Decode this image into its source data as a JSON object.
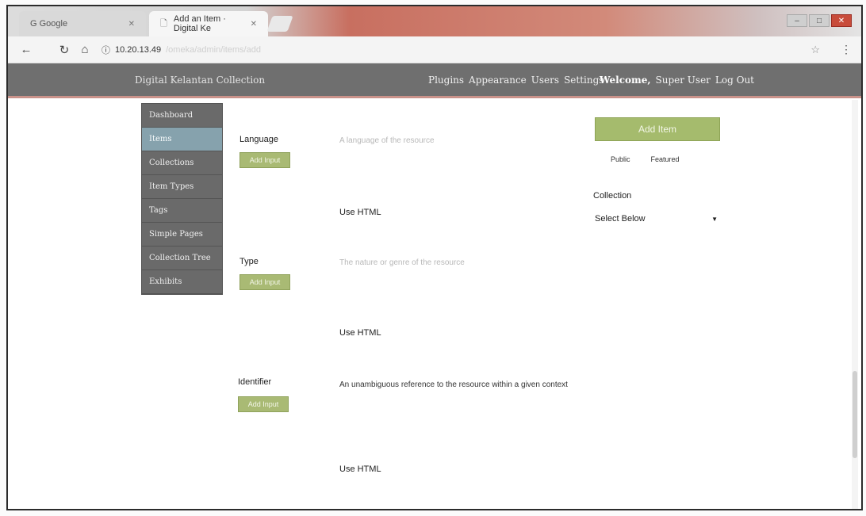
{
  "browser": {
    "tabs": [
      {
        "label": "G Google",
        "active": false
      },
      {
        "label": "Add an Item · Digital Ke",
        "active": true
      }
    ],
    "url": "10.20.13.49",
    "url_rest": "/omeka/admin/items/add"
  },
  "admin": {
    "site_title": "Digital Kelantan Collection",
    "nav": [
      "Plugins",
      "Appearance",
      "Users",
      "Settings"
    ],
    "welcome_prefix": "Welcome,",
    "user": "Super User",
    "logout": "Log Out"
  },
  "sidebar": {
    "items": [
      {
        "label": "Dashboard",
        "active": false
      },
      {
        "label": "Items",
        "active": true
      },
      {
        "label": "Collections",
        "active": false
      },
      {
        "label": "Item Types",
        "active": false
      },
      {
        "label": "Tags",
        "active": false
      },
      {
        "label": "Simple Pages",
        "active": false
      },
      {
        "label": "Collection Tree",
        "active": false
      },
      {
        "label": "Exhibits",
        "active": false
      }
    ]
  },
  "fields": [
    {
      "label": "Language",
      "add_input": "Add Input",
      "description": "A language of the resource",
      "use_html": "Use HTML"
    },
    {
      "label": "Type",
      "add_input": "Add Input",
      "description": "The nature or genre of the resource",
      "use_html": "Use HTML"
    },
    {
      "label": "Identifier",
      "add_input": "Add Input",
      "description": "An unambiguous reference to the resource within a given context",
      "use_html": "Use HTML"
    }
  ],
  "right_panel": {
    "add_item": "Add Item",
    "public": "Public",
    "featured": "Featured",
    "collection_label": "Collection",
    "collection_value": "Select Below"
  },
  "colors": {
    "accent_green": "#a5bb6d",
    "sidebar_gray": "#6a6a6a",
    "sidebar_active": "#86a2ad",
    "header_gray": "#6f6f6f"
  }
}
